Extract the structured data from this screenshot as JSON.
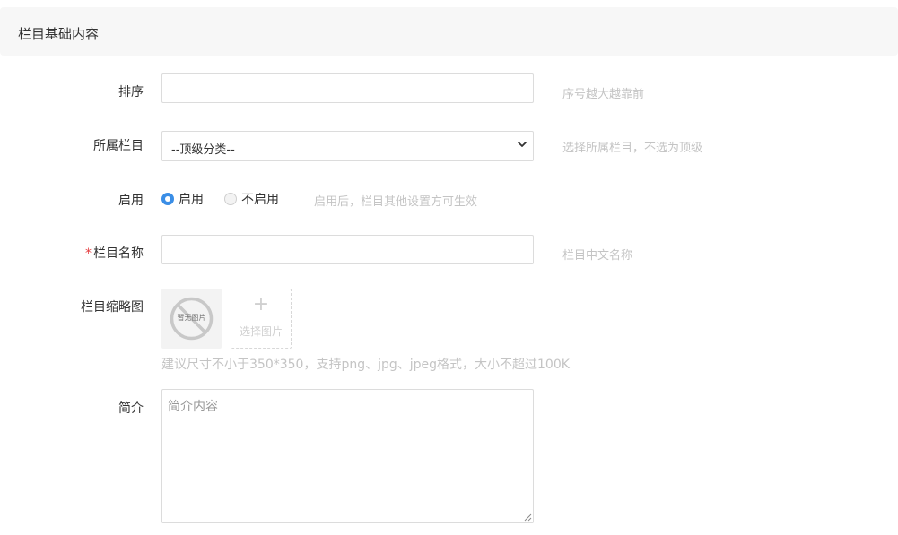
{
  "section": {
    "title": "栏目基础内容"
  },
  "fields": {
    "sort": {
      "label": "排序",
      "value": "",
      "hint": "序号越大越靠前"
    },
    "parent": {
      "label": "所属栏目",
      "selected": "--顶级分类--",
      "hint": "选择所属栏目，不选为顶级"
    },
    "enabled": {
      "label": "启用",
      "options": [
        {
          "label": "启用",
          "checked": true
        },
        {
          "label": "不启用",
          "checked": false
        }
      ],
      "hint": "启用后，栏目其他设置方可生效"
    },
    "name": {
      "required_mark": "*",
      "label": "栏目名称",
      "value": "",
      "hint": "栏目中文名称"
    },
    "thumbnail": {
      "label": "栏目缩略图",
      "no_image_text": "暂无图片",
      "upload_plus": "+",
      "upload_label": "选择图片",
      "hint": "建议尺寸不小于350*350，支持png、jpg、jpeg格式，大小不超过100K"
    },
    "intro": {
      "label": "简介",
      "placeholder": "简介内容"
    }
  },
  "colors": {
    "accent": "#3a8ee6",
    "hint": "#c4c4c4",
    "required": "#e4393c",
    "header_bg": "#f7f7f7"
  },
  "icons": {
    "select_caret": "chevron-down-icon",
    "no_image": "no-image-icon",
    "upload": "plus-icon"
  }
}
